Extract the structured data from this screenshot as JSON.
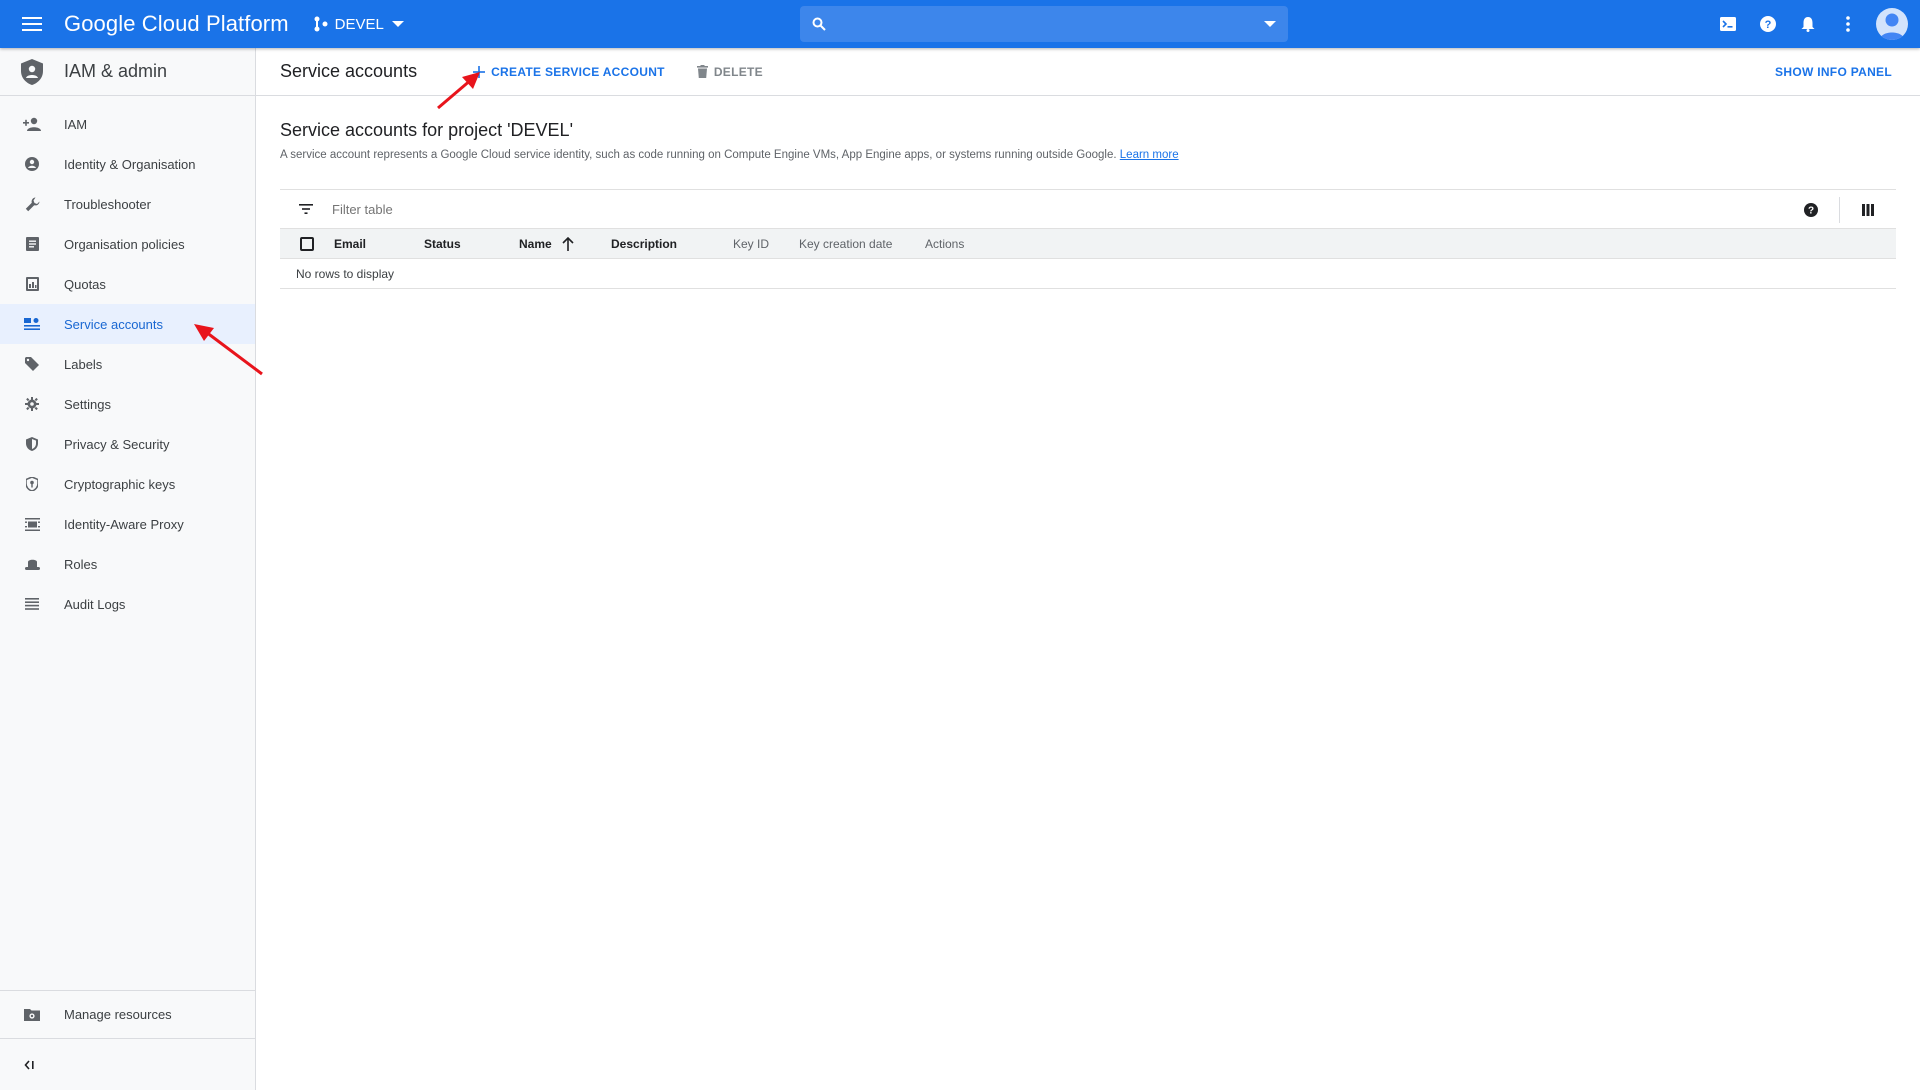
{
  "topbar": {
    "brand": "Google Cloud Platform",
    "project": "DEVEL",
    "search_placeholder": ""
  },
  "sidebar": {
    "title": "IAM & admin",
    "items": [
      {
        "label": "IAM",
        "icon": "person-add-icon"
      },
      {
        "label": "Identity & Organisation",
        "icon": "account-circle-icon"
      },
      {
        "label": "Troubleshooter",
        "icon": "wrench-icon"
      },
      {
        "label": "Organisation policies",
        "icon": "document-icon"
      },
      {
        "label": "Quotas",
        "icon": "quota-icon"
      },
      {
        "label": "Service accounts",
        "icon": "service-account-icon",
        "active": true
      },
      {
        "label": "Labels",
        "icon": "tag-icon"
      },
      {
        "label": "Settings",
        "icon": "gear-icon"
      },
      {
        "label": "Privacy & Security",
        "icon": "shield-icon"
      },
      {
        "label": "Cryptographic keys",
        "icon": "key-shield-icon"
      },
      {
        "label": "Identity-Aware Proxy",
        "icon": "proxy-icon"
      },
      {
        "label": "Roles",
        "icon": "hat-icon"
      },
      {
        "label": "Audit Logs",
        "icon": "list-icon"
      }
    ],
    "manage_resources": "Manage resources"
  },
  "toolbar": {
    "page_title": "Service accounts",
    "create_label": "CREATE SERVICE ACCOUNT",
    "delete_label": "DELETE",
    "info_label": "SHOW INFO PANEL"
  },
  "content": {
    "heading": "Service accounts for project 'DEVEL'",
    "description": "A service account represents a Google Cloud service identity, such as code running on Compute Engine VMs, App Engine apps, or systems running outside Google.",
    "learn_more": "Learn more"
  },
  "table": {
    "filter_placeholder": "Filter table",
    "columns": [
      "Email",
      "Status",
      "Name",
      "Description",
      "Key ID",
      "Key creation date",
      "Actions"
    ],
    "empty_text": "No rows to display"
  },
  "colors": {
    "brand_blue": "#1a73e8",
    "annotation_red": "#e8141c"
  }
}
